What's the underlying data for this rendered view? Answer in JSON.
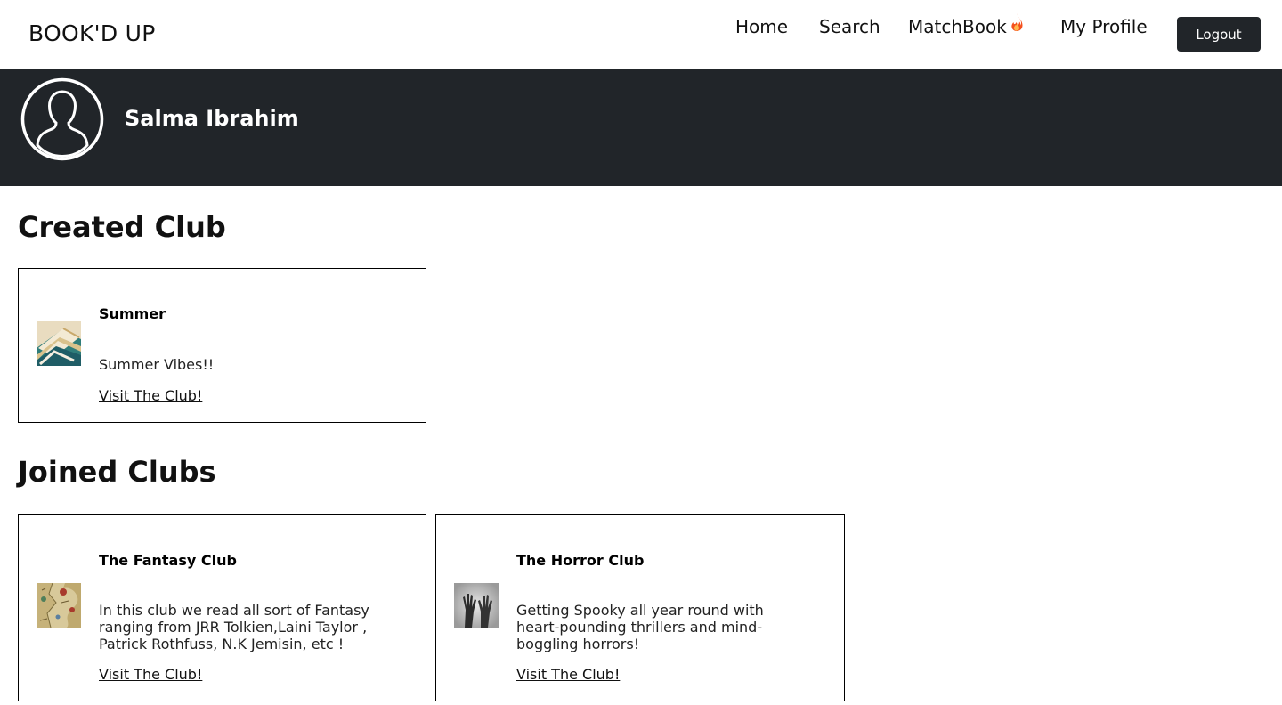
{
  "brand": "BOOK'D UP",
  "nav": {
    "home": "Home",
    "search": "Search",
    "matchbook": "MatchBook",
    "my_profile": "My Profile",
    "logout": "Logout"
  },
  "profile": {
    "name": "Salma Ibrahim"
  },
  "created_section": {
    "title": "Created Club",
    "clubs": [
      {
        "name": "Summer",
        "description": "Summer Vibes!!",
        "link": "Visit The Club!",
        "thumbnail": "open-book-pages-image"
      }
    ]
  },
  "joined_section": {
    "title": "Joined Clubs",
    "clubs": [
      {
        "name": "The Fantasy Club",
        "description": "In this club we read all sort of Fantasy ranging from JRR Tolkien,Laini Taylor , Patrick Rothfuss, N.K Jemisin, etc !",
        "link": "Visit The Club!",
        "thumbnail": "fantasy-map-image"
      },
      {
        "name": "The Horror Club",
        "description": "Getting Spooky all year round with heart-pounding thrillers and mind-boggling horrors!",
        "link": "Visit The Club!",
        "thumbnail": "hands-behind-glass-image"
      }
    ]
  },
  "colors": {
    "dark": "#212529",
    "background": "#ffffff",
    "text": "#000000",
    "flame": "#f4511e"
  },
  "icons": {
    "avatar": "user-silhouette-icon",
    "matchbook": "fire-icon"
  }
}
